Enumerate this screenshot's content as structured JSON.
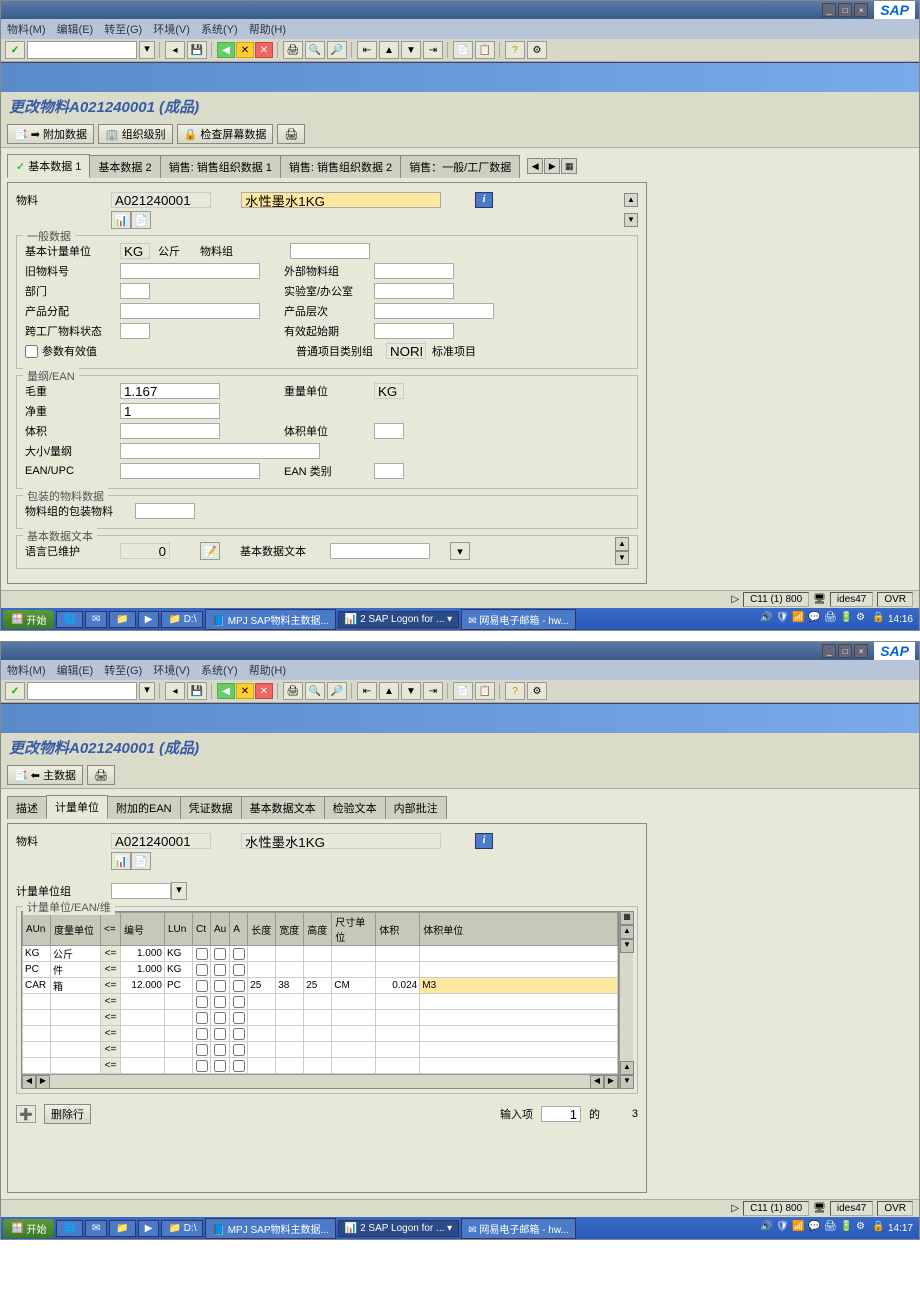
{
  "menus": {
    "m": "物料(M)",
    "e": "编辑(E)",
    "g": "转至(G)",
    "v": "环境(V)",
    "y": "系统(Y)",
    "h": "帮助(H)"
  },
  "sap_logo": "SAP",
  "page_title": "更改物料A021240001 (成品)",
  "win1": {
    "sub_toolbar": {
      "additional": "附加数据",
      "org": "组织级别",
      "check": "检查屏幕数据"
    },
    "tabs": {
      "t1": "基本数据 1",
      "t2": "基本数据 2",
      "t3": "销售: 销售组织数据 1",
      "t4": "销售: 销售组织数据 2",
      "t5": "销售：一般/工厂数据"
    },
    "header": {
      "material_label": "物料",
      "material": "A021240001",
      "desc": "水性墨水1KG"
    },
    "general": {
      "title": "一般数据",
      "uom_label": "基本计量单位",
      "uom": "KG",
      "uom_text": "公斤",
      "matgroup_label": "物料组",
      "old_mat_label": "旧物料号",
      "ext_matgroup_label": "外部物料组",
      "division_label": "部门",
      "lab_label": "实验室/办公室",
      "assignment_label": "产品分配",
      "hier_label": "产品层次",
      "xplant_label": "跨工厂物料状态",
      "valid_from_label": "有效起始期",
      "param_valid": "参数有效值",
      "gitem_label": "普通项目类别组",
      "gitem": "NORM",
      "gitem_text": "标准项目"
    },
    "dim": {
      "title": "量纲/EAN",
      "gross_label": "毛重",
      "gross": "1.167",
      "wunit_label": "重量单位",
      "wunit": "KG",
      "net_label": "净重",
      "net": "1",
      "vol_label": "体积",
      "vunit_label": "体积单位",
      "size_label": "大小/量纲",
      "ean_label": "EAN/UPC",
      "eancat_label": "EAN 类别"
    },
    "pack": {
      "title": "包装的物料数据",
      "pmg_label": "物料组的包装物料"
    },
    "text": {
      "title": "基本数据文本",
      "lang_label": "语言已维护",
      "lang": "0",
      "btext_label": "基本数据文本"
    },
    "status": {
      "sys": "C11 (1) 800",
      "srv": "ides47",
      "mode": "OVR"
    },
    "taskbar": {
      "start": "开始",
      "d": "D:\\",
      "item1": "MPJ SAP物料主数据...",
      "item2": "2 SAP Logon for ...",
      "item3": "网易电子邮箱 - hw...",
      "time": "14:16"
    }
  },
  "win2": {
    "sub_toolbar": {
      "main": "主数据"
    },
    "tabs": {
      "t1": "描述",
      "t2": "计量单位",
      "t3": "附加的EAN",
      "t4": "凭证数据",
      "t5": "基本数据文本",
      "t6": "检验文本",
      "t7": "内部批注"
    },
    "header": {
      "material_label": "物料",
      "material": "A021240001",
      "desc": "水性墨水1KG"
    },
    "uom_group_label": "计量单位组",
    "grid_title": "计量单位/EAN/维",
    "cols": {
      "aun": "AUn",
      "meas": "度量单位",
      "arrow": "<=",
      "num": "编号",
      "lun": "LUn",
      "ct": "Ct",
      "au": "Au",
      "a": "A",
      "len": "长度",
      "wid": "宽度",
      "hei": "高度",
      "sunit": "尺寸单位",
      "vol": "体积",
      "vunit": "体积单位"
    },
    "rows": [
      {
        "aun": "KG",
        "meas": "公斤",
        "num": "1.000",
        "lun": "KG"
      },
      {
        "aun": "PC",
        "meas": "件",
        "num": "1.000",
        "lun": "KG"
      },
      {
        "aun": "CAR",
        "meas": "箱",
        "num": "12.000",
        "lun": "PC",
        "len": "25",
        "wid": "38",
        "hei": "25",
        "sunit": "CM",
        "vol": "0.024",
        "vunit": "M3"
      }
    ],
    "arrow": "<=",
    "footer": {
      "delete_row": "删除行",
      "entry": "输入项",
      "cur": "1",
      "of": "的",
      "total": "3"
    },
    "status": {
      "sys": "C11 (1) 800",
      "srv": "ides47",
      "mode": "OVR"
    },
    "taskbar": {
      "start": "开始",
      "d": "D:\\",
      "item1": "MPJ SAP物料主数据...",
      "item2": "2 SAP Logon for ...",
      "item3": "网易电子邮箱 - hw...",
      "time": "14:17"
    }
  }
}
